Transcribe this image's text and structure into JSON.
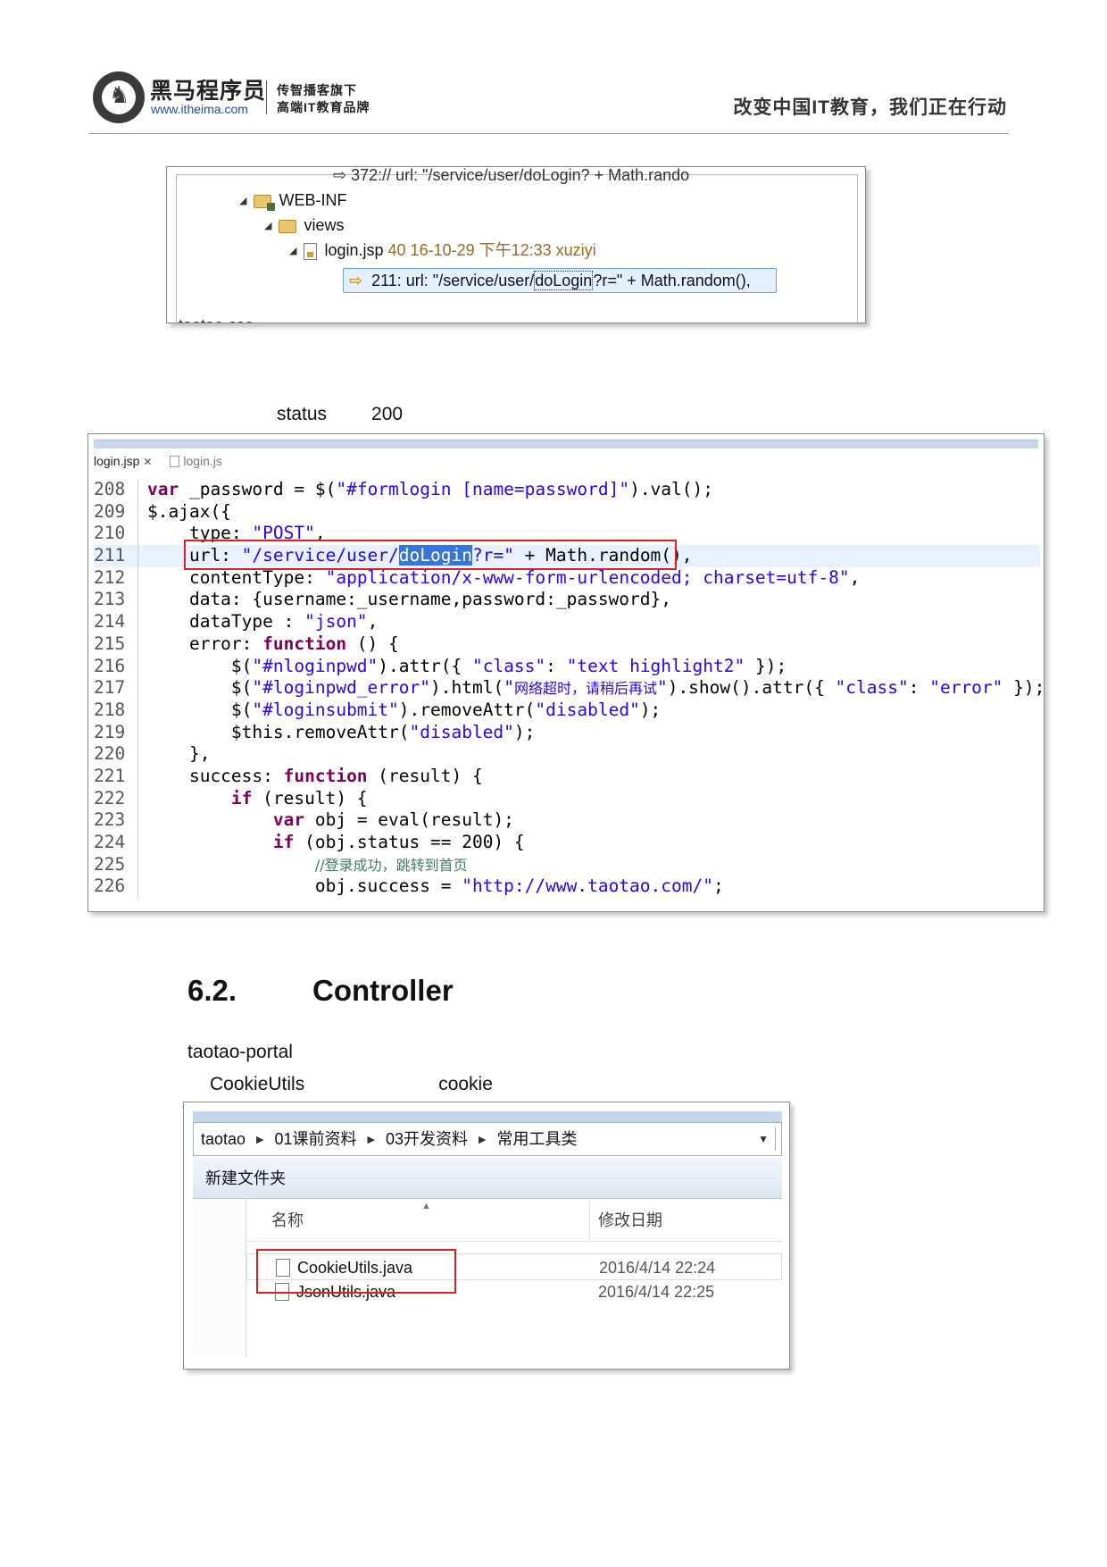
{
  "header": {
    "brand_cn": "黑马程序员",
    "brand_url": "www.itheima.com",
    "brand_sub1": "传智播客旗下",
    "brand_sub2": "高端IT教育品牌",
    "slogan": "改变中国IT教育，我们正在行动",
    "logo_icon": "horse-logo-icon"
  },
  "shot1": {
    "cut_top": "⇨ 372://          url: \"/service/user/doLogin?      + Math.rando",
    "web_inf": "WEB-INF",
    "views": "views",
    "file_name": "login.jsp",
    "file_meta": "40  16-10-29 下午12:33  xuziyi",
    "match_prefix": "211: url: \"/service/user/",
    "match_sel": "doLogin",
    "match_suffix": "?r=\" + Math.random(),",
    "cut_bottom": "taotao-sso"
  },
  "status_line": {
    "word": "status",
    "code": "200"
  },
  "shot2": {
    "tab_active": "login.jsp",
    "tab_inactive": "login.js",
    "lines": [
      {
        "n": "208"
      },
      {
        "n": "209"
      },
      {
        "n": "210"
      },
      {
        "n": "211"
      },
      {
        "n": "212"
      },
      {
        "n": "213"
      },
      {
        "n": "214"
      },
      {
        "n": "215"
      },
      {
        "n": "216"
      },
      {
        "n": "217"
      },
      {
        "n": "218"
      },
      {
        "n": "219"
      },
      {
        "n": "220"
      },
      {
        "n": "221"
      },
      {
        "n": "222"
      },
      {
        "n": "223"
      },
      {
        "n": "224"
      },
      {
        "n": "225"
      },
      {
        "n": "226"
      }
    ],
    "code": {
      "l208_kw": "var",
      "l208_a": " _password = $(",
      "l208_s": "\"#formlogin [name=password]\"",
      "l208_b": ").val();",
      "l209": "$.ajax({",
      "l210_a": "    type: ",
      "l210_s": "\"POST\"",
      "l210_b": ",",
      "l211_a": "    url: ",
      "l211_s1": "\"/service/user/",
      "l211_hl": "doLogin",
      "l211_s2": "?r=\"",
      "l211_b": " + Math.random(),",
      "l212_a": "    contentType: ",
      "l212_s": "\"application/x-www-form-urlencoded; charset=utf-8\"",
      "l212_b": ",",
      "l213": "    data: {username:_username,password:_password},",
      "l214_a": "    dataType : ",
      "l214_s": "\"json\"",
      "l214_b": ",",
      "l215_a": "    error: ",
      "l215_kw": "function",
      "l215_b": " () {",
      "l216_a": "        $(",
      "l216_s1": "\"#nloginpwd\"",
      "l216_b": ").attr({ ",
      "l216_s2": "\"class\"",
      "l216_c": ": ",
      "l216_s3": "\"text highlight2\"",
      "l216_d": " });",
      "l217_a": "        $(",
      "l217_s1": "\"#loginpwd_error\"",
      "l217_b": ").html(",
      "l217_s2a": "\"",
      "l217_cn": "网络超时，请稍后再试",
      "l217_s2b": "\"",
      "l217_c": ").show().attr({ ",
      "l217_s3": "\"class\"",
      "l217_d": ": ",
      "l217_s4": "\"error\"",
      "l217_e": " });",
      "l218_a": "        $(",
      "l218_s1": "\"#loginsubmit\"",
      "l218_b": ").removeAttr(",
      "l218_s2": "\"disabled\"",
      "l218_c": ");",
      "l219_a": "        $this.removeAttr(",
      "l219_s": "\"disabled\"",
      "l219_b": ");",
      "l220": "    },",
      "l221_a": "    success: ",
      "l221_kw": "function",
      "l221_b": " (result) {",
      "l222_a": "        ",
      "l222_kw": "if",
      "l222_b": " (result) {",
      "l223_a": "            ",
      "l223_kw": "var",
      "l223_b": " obj = eval(result);",
      "l224_a": "            ",
      "l224_kw": "if",
      "l224_b": " (obj.status == 200) {",
      "l225_a": "                ",
      "l225_c": "//",
      "l225_cn": "登录成功，跳转到首页",
      "l226_a": "                obj.success = ",
      "l226_s": "\"http://www.taotao.com/\"",
      "l226_b": ";"
    }
  },
  "section": {
    "number": "6.2.",
    "title": "Controller"
  },
  "para1": "taotao-portal",
  "para2": {
    "left": "CookieUtils",
    "right": "cookie"
  },
  "shot3": {
    "crumbs": [
      "taotao",
      "01课前资料",
      "03开发资料",
      "常用工具类"
    ],
    "toolbar_label": "新建文件夹",
    "col_name": "名称",
    "col_date": "修改日期",
    "files": [
      {
        "name": "CookieUtils.java",
        "date": "2016/4/14 22:24"
      },
      {
        "name": "JsonUtils.java",
        "date": "2016/4/14 22:25"
      }
    ]
  }
}
